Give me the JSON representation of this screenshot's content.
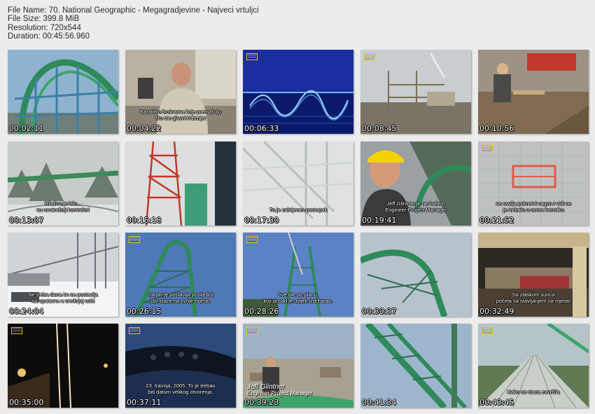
{
  "info": {
    "file_name": "File Name: 70. National Geographic - Megagradjevine - Najveci vrtuljci",
    "file_size": "File Size: 399.8 MiB",
    "resolution": "Resolution: 720x544",
    "duration": "Duration: 00:45:56.960"
  },
  "thumbnails": [
    {
      "time": "00:02:11",
      "subtitle": "",
      "icons": []
    },
    {
      "time": "00:04:22",
      "subtitle": "Baratimo brzinama koje premašuju\nšto ste glavni inženjer",
      "icons": []
    },
    {
      "time": "00:06:33",
      "subtitle": "",
      "icons": [
        "ng-logo-icon"
      ]
    },
    {
      "time": "00:08:45",
      "subtitle": "",
      "icons": [
        "ng-logo-icon"
      ]
    },
    {
      "time": "00:10:56",
      "subtitle": "",
      "icons": []
    },
    {
      "time": "00:13:07",
      "subtitle": "Hladno je bilo...\nsu unutrašnji kontrolori",
      "icons": []
    },
    {
      "time": "00:15:18",
      "subtitle": "",
      "icons": []
    },
    {
      "time": "00:17:30",
      "subtitle": "To je zahtjevan postupak",
      "icons": []
    },
    {
      "time": "00:19:41",
      "subtitle": "Jeff Glintner je ne kažem\nEngineer-Project Manager",
      "icons": []
    },
    {
      "time": "00:21:52",
      "subtitle": "se savija pokretni vagon i vidi se\nje trebalo u ovom trenutku",
      "icons": [
        "ng-logo-icon"
      ]
    },
    {
      "time": "00:24:04",
      "subtitle": "Ne treba dana im se postavlja\nsa uputama u srednjoj sobi",
      "icons": []
    },
    {
      "time": "00:26:15",
      "subtitle": "Danas je postavlja posljednji\ndio staze na svoje mjesto",
      "icons": [
        "ng-logo-icon"
      ]
    },
    {
      "time": "00:28:26",
      "subtitle": "Sve ide po planu,\nkoji dosad je uvijek izdržavao.",
      "icons": [
        "ng-logo-icon"
      ]
    },
    {
      "time": "00:30:37",
      "subtitle": "",
      "icons": []
    },
    {
      "time": "00:32:49",
      "subtitle": "Sa zlaskom sunca\npočela sa stavljanjem na mjesto",
      "icons": []
    },
    {
      "time": "00:35:00",
      "subtitle": "",
      "icons": [
        "ng-logo-icon"
      ]
    },
    {
      "time": "00:37:11",
      "subtitle": "23. travnja, 2005. To je trebao\nbiti datum velikog otvorenja.",
      "icons": [
        "ng-logo-icon"
      ]
    },
    {
      "time": "00:39:23",
      "subtitle": "",
      "caption_name": "Jeff Glintner",
      "caption_title": "Engineer-Project Manager",
      "icons": [
        "ng-logo-icon"
      ]
    },
    {
      "time": "00:41:34",
      "subtitle": "",
      "icons": []
    },
    {
      "time": "00:43:45",
      "subtitle": "Kako se staza završila",
      "icons": [
        "ng-logo-icon"
      ]
    }
  ],
  "colors": {
    "background": "#ececec",
    "track_green": "#2f8a5a",
    "ng_yellow": "#f2c800"
  }
}
